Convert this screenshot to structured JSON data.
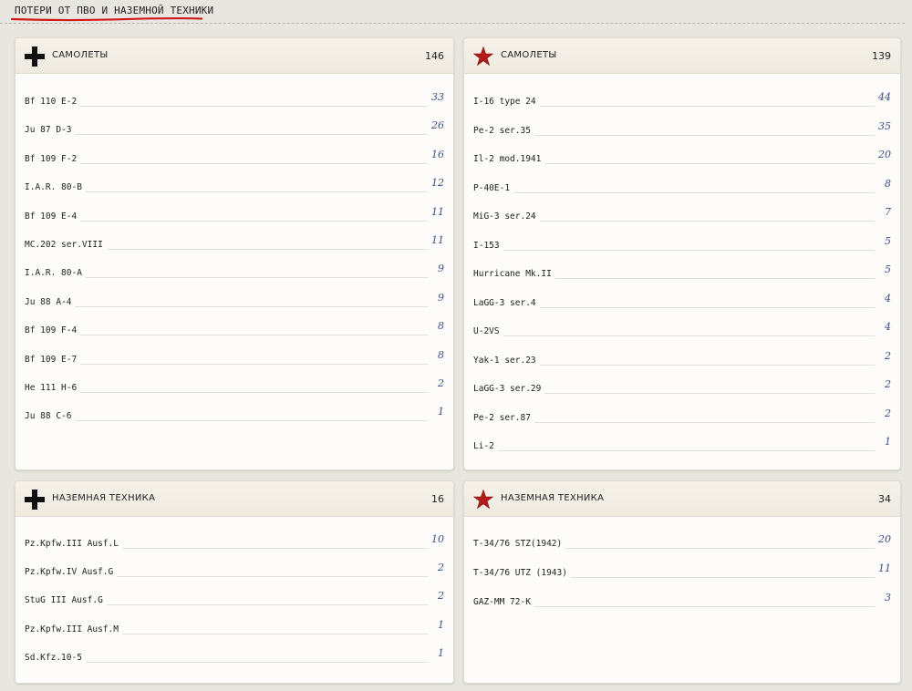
{
  "header": {
    "title": "ПОТЕРИ ОТ ПВО И НАЗЕМНОЙ ТЕХНИКИ"
  },
  "colors": {
    "accent_underline": "#d01a1a",
    "count_text": "#3a4f86",
    "soviet_star": "#b31b1b",
    "german_cross": "#111111"
  },
  "cards": {
    "german_air": {
      "icon": "balkenkreuz-icon",
      "title": "САМОЛЕТЫ",
      "total": "146",
      "rows": [
        {
          "name": "Bf 110 E-2",
          "count": "33"
        },
        {
          "name": "Ju 87 D-3",
          "count": "26"
        },
        {
          "name": "Bf 109 F-2",
          "count": "16"
        },
        {
          "name": "I.A.R. 80-B",
          "count": "12"
        },
        {
          "name": "Bf 109 E-4",
          "count": "11"
        },
        {
          "name": "MC.202 ser.VIII",
          "count": "11"
        },
        {
          "name": "I.A.R. 80-A",
          "count": "9"
        },
        {
          "name": "Ju 88 A-4",
          "count": "9"
        },
        {
          "name": "Bf 109 F-4",
          "count": "8"
        },
        {
          "name": "Bf 109 E-7",
          "count": "8"
        },
        {
          "name": "He 111 H-6",
          "count": "2"
        },
        {
          "name": "Ju 88 C-6",
          "count": "1"
        }
      ]
    },
    "soviet_air": {
      "icon": "red-star-icon",
      "title": "САМОЛЕТЫ",
      "total": "139",
      "rows": [
        {
          "name": "I-16 type 24",
          "count": "44"
        },
        {
          "name": "Pe-2 ser.35",
          "count": "35"
        },
        {
          "name": "Il-2 mod.1941",
          "count": "20"
        },
        {
          "name": "P-40E-1",
          "count": "8"
        },
        {
          "name": "MiG-3 ser.24",
          "count": "7"
        },
        {
          "name": "I-153",
          "count": "5"
        },
        {
          "name": "Hurricane Mk.II",
          "count": "5"
        },
        {
          "name": "LaGG-3 ser.4",
          "count": "4"
        },
        {
          "name": "U-2VS",
          "count": "4"
        },
        {
          "name": "Yak-1 ser.23",
          "count": "2"
        },
        {
          "name": "LaGG-3 ser.29",
          "count": "2"
        },
        {
          "name": "Pe-2 ser.87",
          "count": "2"
        },
        {
          "name": "Li-2",
          "count": "1"
        }
      ]
    },
    "german_ground": {
      "icon": "balkenkreuz-icon",
      "title": "НАЗЕМНАЯ ТЕХНИКА",
      "total": "16",
      "rows": [
        {
          "name": "Pz.Kpfw.III Ausf.L",
          "count": "10"
        },
        {
          "name": "Pz.Kpfw.IV Ausf.G",
          "count": "2"
        },
        {
          "name": "StuG III Ausf.G",
          "count": "2"
        },
        {
          "name": "Pz.Kpfw.III Ausf.M",
          "count": "1"
        },
        {
          "name": "Sd.Kfz.10-5",
          "count": "1"
        }
      ]
    },
    "soviet_ground": {
      "icon": "red-star-icon",
      "title": "НАЗЕМНАЯ ТЕХНИКА",
      "total": "34",
      "rows": [
        {
          "name": "T-34/76 STZ(1942)",
          "count": "20"
        },
        {
          "name": "T-34/76 UTZ (1943)",
          "count": "11"
        },
        {
          "name": "GAZ-MM 72-K",
          "count": "3"
        }
      ]
    }
  }
}
